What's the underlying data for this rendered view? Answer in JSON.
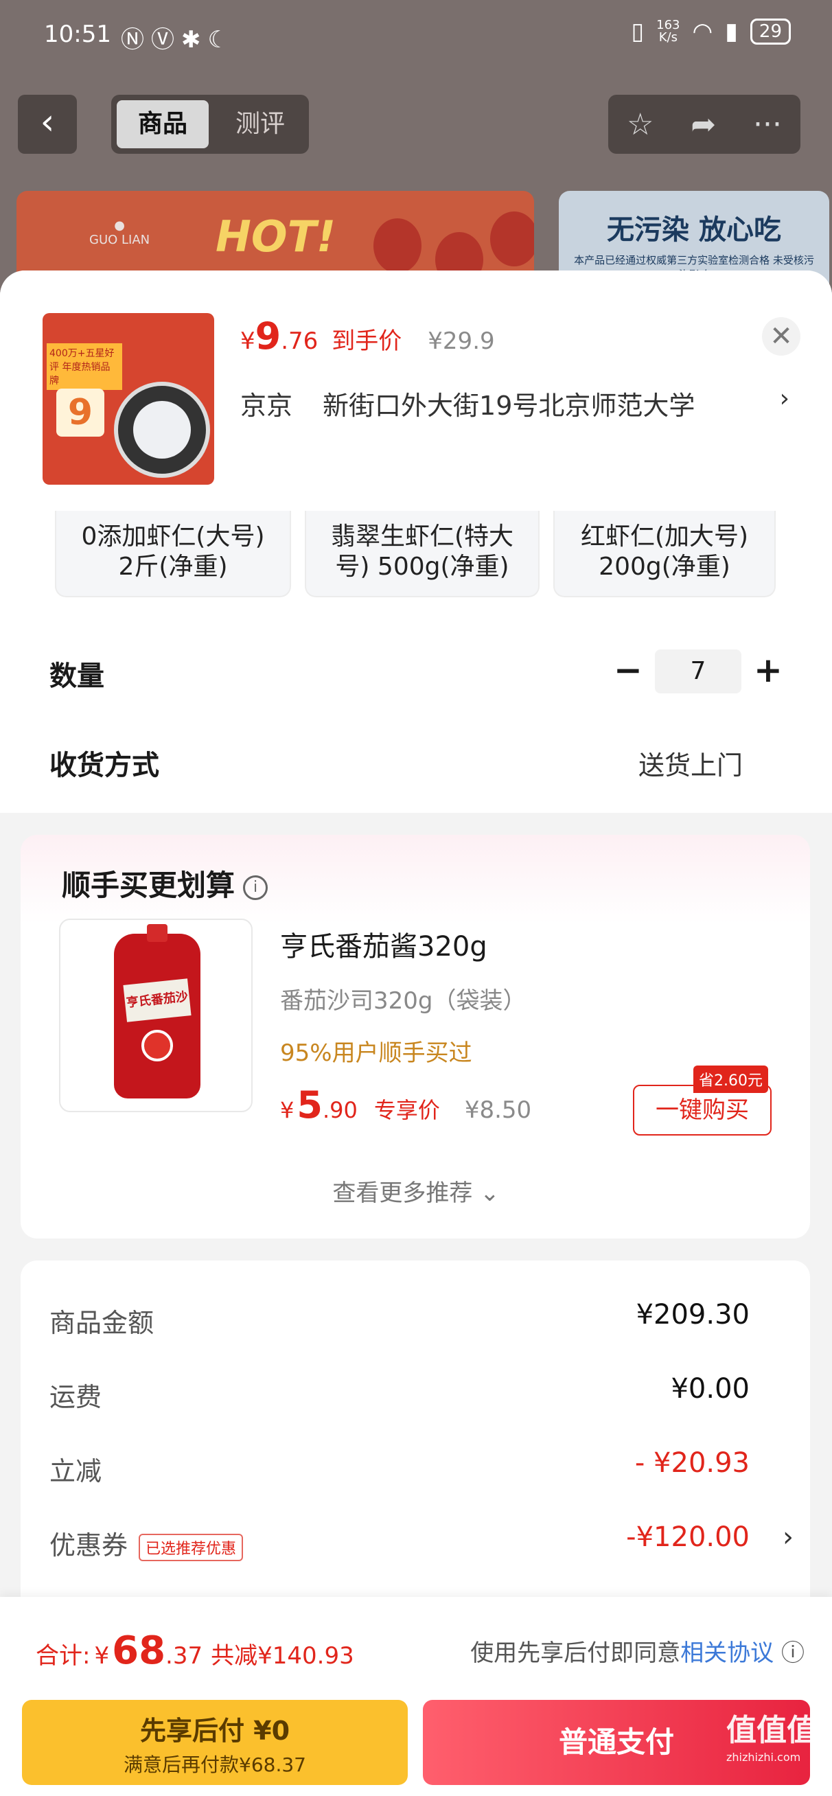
{
  "status": {
    "time": "10:51",
    "icons": "ⓃⓋ✱☾",
    "net_speed_value": "163",
    "net_speed_unit": "K/s",
    "battery": "29"
  },
  "nav": {
    "back_icon": "‹",
    "tabs": [
      {
        "label": "商品"
      },
      {
        "label": "测评"
      }
    ],
    "icons": [
      "☆",
      "➦",
      "···"
    ]
  },
  "banner": {
    "hot": "HOT!",
    "logo": "GUO LIAN",
    "right_title": "无污染 放心吃",
    "right_sub": "本产品已经通过权威第三方实验室检测合格 未受核污染影响"
  },
  "header": {
    "thumb": {
      "tag": "400万+五星好评 年度热销品牌",
      "num": "9"
    },
    "price": {
      "yen": "¥",
      "int": "9",
      "dec": ".76",
      "tag": "到手价",
      "orig": "¥29.9"
    },
    "close_icon": "✕",
    "address": {
      "city": "京京",
      "detail": "新街口外大街19号北京师范大学",
      "chevron": "›"
    }
  },
  "variants": [
    {
      "line1": "0添加虾仁(大号)",
      "line2": "2斤(净重)"
    },
    {
      "line1": "翡翠生虾仁(特大",
      "line2": "号) 500g(净重)"
    },
    {
      "line1": "红虾仁(加大号)",
      "line2": "200g(净重)"
    }
  ],
  "quantity": {
    "label": "数量",
    "minus": "−",
    "value": "7",
    "plus": "+"
  },
  "delivery": {
    "label": "收货方式",
    "value": "送货上门"
  },
  "recommend": {
    "title": "顺手买更划算",
    "info_icon": "i",
    "product": {
      "img_label": "亨氏番茄沙司",
      "name": "亨氏番茄酱320g",
      "spec": "番茄沙司320g（袋装）",
      "pct": "95%用户顺手买过",
      "price": {
        "yen": "¥",
        "int": "5",
        "dec": ".90",
        "tag": "专享价",
        "orig": "¥8.50"
      },
      "save_badge": "省2.60元",
      "buy_label": "一键购买"
    },
    "more": "查看更多推荐 ⌄"
  },
  "summary": [
    {
      "label": "商品金额",
      "value": "¥209.30"
    },
    {
      "label": "运费",
      "value": "¥0.00"
    },
    {
      "label": "立减",
      "value": "- ¥20.93"
    },
    {
      "label": "优惠券",
      "tag": "已选推荐优惠",
      "value": "-¥120.00",
      "chevron": "›"
    }
  ],
  "bottom": {
    "total_label": "合计:",
    "total_yen": "¥",
    "total_int": "68",
    "total_dec": ".37",
    "total_save": "共减¥140.93",
    "agree_text": "使用先享后付即同意",
    "agree_link": "相关协议",
    "agree_icon": "ⓘ",
    "later_l1": "先享后付 ¥0",
    "later_l2": "满意后再付款¥68.37",
    "pay_label": "普通支付"
  },
  "watermark": {
    "main": "值值值",
    "sub": "zhizhizhi.com"
  }
}
